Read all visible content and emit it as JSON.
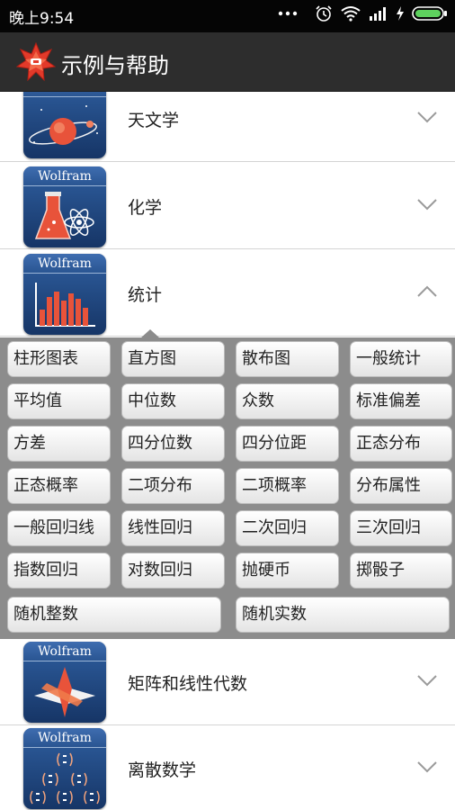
{
  "status_bar": {
    "time": "晚上9:54"
  },
  "app_bar": {
    "title": "示例与帮助"
  },
  "tile_brand": "Wolfram",
  "categories": [
    {
      "label": "天文学",
      "icon": "astronomy-icon",
      "expanded": false
    },
    {
      "label": "化学",
      "icon": "chemistry-flask-icon",
      "expanded": false
    },
    {
      "label": "统计",
      "icon": "statistics-chart-icon",
      "expanded": true
    },
    {
      "label": "矩阵和线性代数",
      "icon": "linear-algebra-icon",
      "expanded": false
    },
    {
      "label": "离散数学",
      "icon": "discrete-math-icon",
      "expanded": false
    }
  ],
  "statistics_items": [
    "柱形图表",
    "直方图",
    "散布图",
    "一般统计",
    "平均值",
    "中位数",
    "众数",
    "标准偏差",
    "方差",
    "四分位数",
    "四分位距",
    "正态分布",
    "正态概率",
    "二项分布",
    "二项概率",
    "分布属性",
    "一般回归线",
    "线性回归",
    "二次回归",
    "三次回归",
    "指数回归",
    "对数回归",
    "抛硬币",
    "掷骰子",
    "随机整数",
    "随机实数"
  ],
  "colors": {
    "app_bar": "#2d2d2d",
    "panel": "#8c8c8c",
    "tile": "#1f4680",
    "accent": "#e8533a"
  }
}
